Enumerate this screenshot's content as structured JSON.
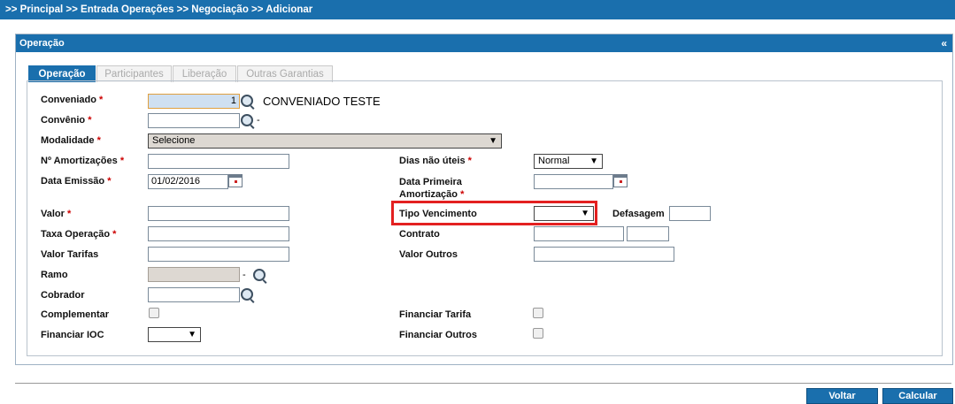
{
  "breadcrumb": ">> Principal >> Entrada Operações  >> Negociação  >> Adicionar",
  "panel": {
    "title": "Operação",
    "collapse": "«"
  },
  "tabs": [
    "Operação",
    "Participantes",
    "Liberação",
    "Outras Garantias"
  ],
  "required_mark": "*",
  "form": {
    "conveniado": {
      "label": "Conveniado",
      "value": "1",
      "name_text": "CONVENIADO TESTE"
    },
    "convenio": {
      "label": "Convênio",
      "value": "",
      "suffix": "-"
    },
    "modalidade": {
      "label": "Modalidade",
      "selected": "Selecione"
    },
    "n_amortizacoes": {
      "label": "Nº Amortizações",
      "value": ""
    },
    "data_emissao": {
      "label": "Data Emissão",
      "value": "01/02/2016"
    },
    "valor": {
      "label": "Valor",
      "value": ""
    },
    "taxa_operacao": {
      "label": "Taxa Operação",
      "value": ""
    },
    "valor_tarifas": {
      "label": "Valor Tarifas",
      "value": ""
    },
    "ramo": {
      "label": "Ramo",
      "value": "",
      "suffix": "-"
    },
    "cobrador": {
      "label": "Cobrador",
      "value": ""
    },
    "complementar": {
      "label": "Complementar"
    },
    "financiar_ioc": {
      "label": "Financiar IOC",
      "selected": ""
    },
    "dias_nao_uteis": {
      "label": "Dias não úteis",
      "selected": "Normal"
    },
    "data_primeira_amortizacao": {
      "label_line1": "Data Primeira",
      "label_line2": "Amortização",
      "value": ""
    },
    "tipo_vencimento": {
      "label": "Tipo Vencimento",
      "selected": ""
    },
    "defasagem": {
      "label": "Defasagem",
      "value": ""
    },
    "contrato": {
      "label": "Contrato",
      "value": "",
      "value2": ""
    },
    "valor_outros": {
      "label": "Valor Outros",
      "value": ""
    },
    "financiar_tarifa": {
      "label": "Financiar Tarifa"
    },
    "financiar_outros": {
      "label": "Financiar Outros"
    }
  },
  "buttons": {
    "voltar": "Voltar",
    "calcular": "Calcular"
  },
  "colors": {
    "primary": "#1a6fad",
    "highlight": "#e32020",
    "required": "#cc0000"
  },
  "icons": {
    "lookup": "magnifier-icon",
    "date": "calendar-icon",
    "dropdown": "dropdown-arrow-icon"
  }
}
